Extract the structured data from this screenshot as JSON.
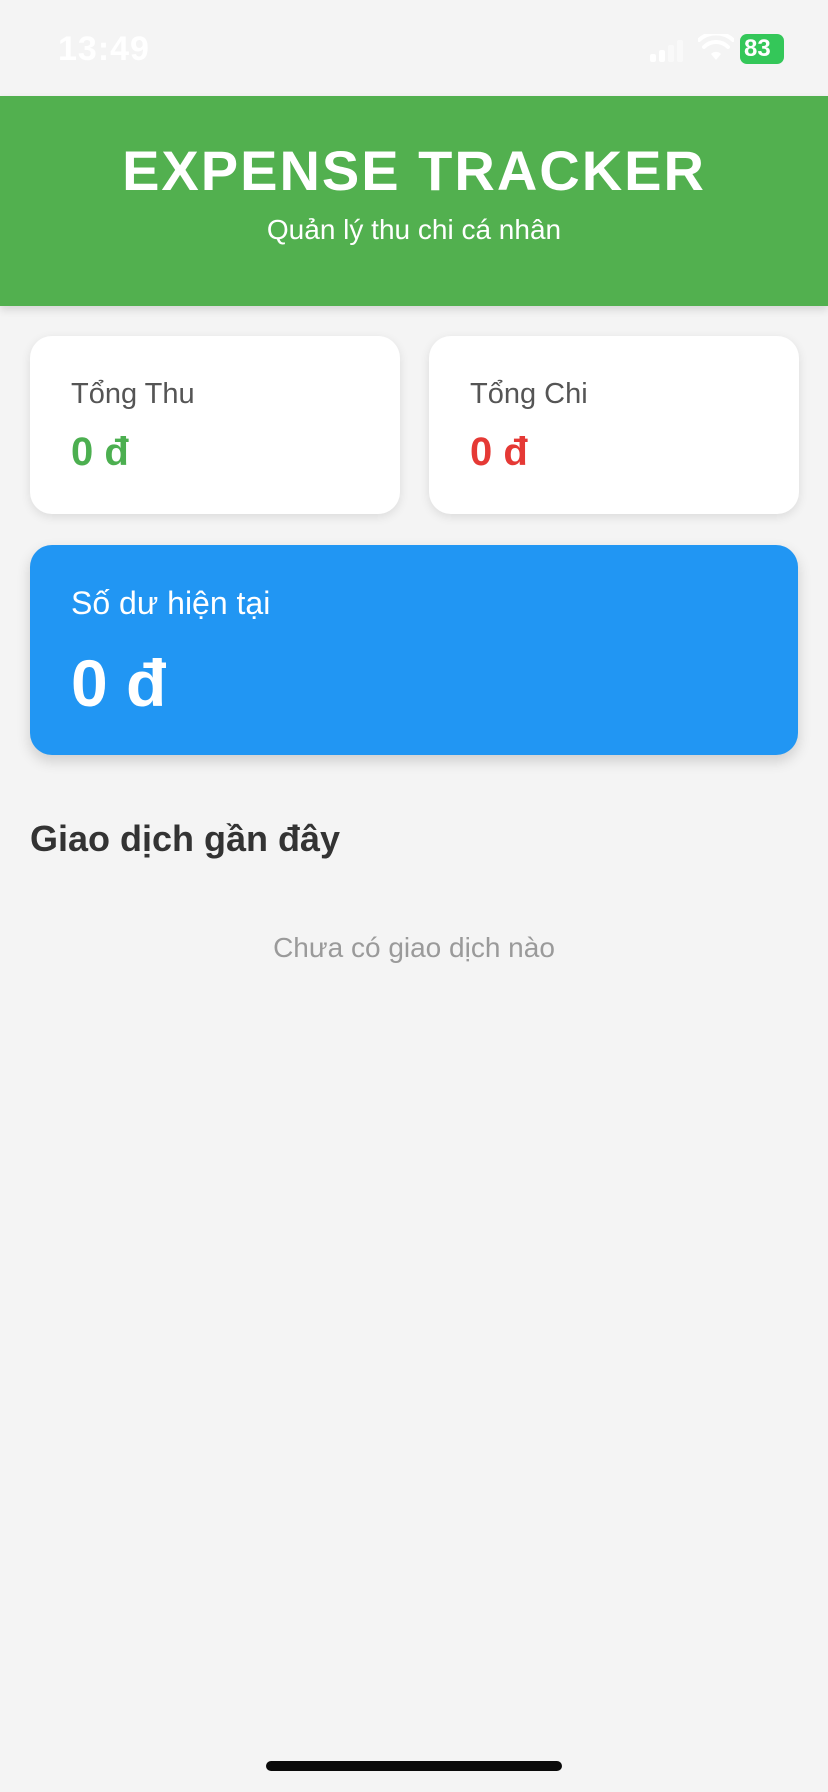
{
  "status_bar": {
    "time": "13:49",
    "battery": "83"
  },
  "header": {
    "title": "EXPENSE TRACKER",
    "subtitle": "Quản lý thu chi cá nhân",
    "color": "#52b04f"
  },
  "summary": {
    "income_label": "Tổng Thu",
    "income_value": "0 đ",
    "income_color": "#4caf50",
    "expense_label": "Tổng Chi",
    "expense_value": "0 đ",
    "expense_color": "#e53935"
  },
  "balance": {
    "label": "Số dư hiện tại",
    "value": "0 đ",
    "color": "#2196f3"
  },
  "transactions": {
    "section_title": "Giao dịch gần đây",
    "empty_message": "Chưa có giao dịch nào",
    "items": []
  }
}
